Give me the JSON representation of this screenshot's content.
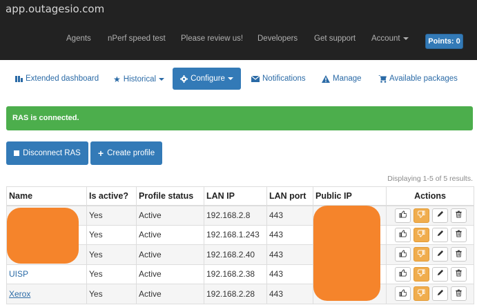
{
  "header": {
    "site": "app.outagesio.com",
    "nav": [
      "Agents",
      "nPerf speed test",
      "Please review us!",
      "Developers",
      "Get support"
    ],
    "account": "Account",
    "points": "Points: 0"
  },
  "subnav": {
    "extended": "Extended dashboard",
    "historical": "Historical",
    "configure": "Configure",
    "notifications": "Notifications",
    "manage": "Manage",
    "packages": "Available packages"
  },
  "alert": "RAS is connected.",
  "buttons": {
    "disconnect": "Disconnect RAS",
    "create": "Create profile"
  },
  "displaying": "Displaying 1-5 of 5 results.",
  "table": {
    "headers": [
      "Name",
      "Is active?",
      "Profile status",
      "LAN IP",
      "LAN port",
      "Public IP",
      "Actions"
    ],
    "rows": [
      {
        "name": "",
        "active": "Yes",
        "status": "Active",
        "lan_ip": "192.168.2.8",
        "port": "443",
        "public_ip": ""
      },
      {
        "name": "",
        "active": "Yes",
        "status": "Active",
        "lan_ip": "192.168.1.243",
        "port": "443",
        "public_ip": ""
      },
      {
        "name": "",
        "active": "Yes",
        "status": "Active",
        "lan_ip": "192.168.2.40",
        "port": "443",
        "public_ip": ""
      },
      {
        "name": "UISP",
        "active": "Yes",
        "status": "Active",
        "lan_ip": "192.168.2.38",
        "port": "443",
        "public_ip": ""
      },
      {
        "name": "Xerox",
        "active": "Yes",
        "status": "Active",
        "lan_ip": "192.168.2.28",
        "port": "443",
        "public_ip": ""
      }
    ]
  },
  "colors": {
    "navbar": "#222222",
    "primary": "#337ab7",
    "success": "#4cae4c",
    "warning": "#f0ad4e",
    "redaction": "#f5842b"
  },
  "icons": [
    "bar-chart-icon",
    "star-icon",
    "gear-icon",
    "envelope-icon",
    "warning-icon",
    "cart-icon",
    "stop-icon",
    "plus-icon",
    "thumbs-up-icon",
    "thumbs-down-icon",
    "pencil-icon",
    "trash-icon"
  ]
}
